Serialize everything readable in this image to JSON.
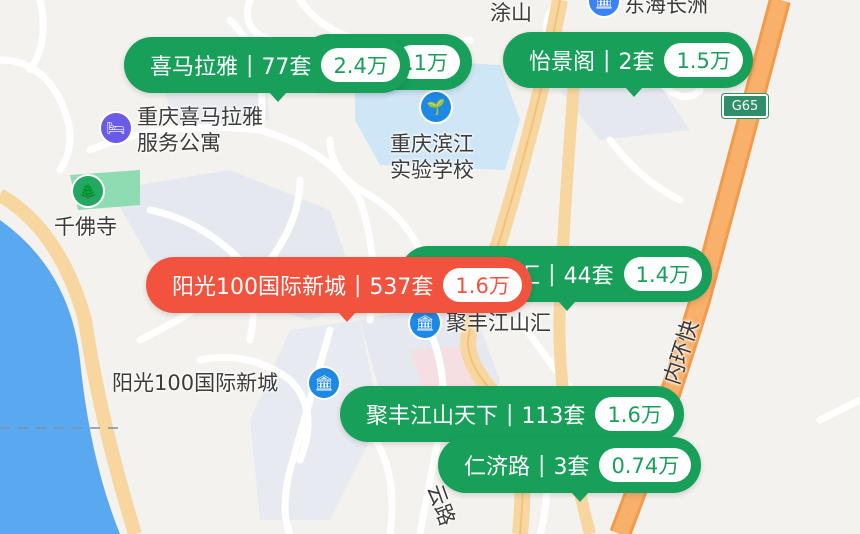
{
  "colors": {
    "listing_green": "#18a05b",
    "listing_red": "#f2533f",
    "water": "#5aa8f0",
    "expressway": "#f5a55c",
    "road_yellow": "#f8d6a0",
    "greenery": "#8fdcb3"
  },
  "highway_shield": "G65",
  "places": [
    {
      "text": "涂山"
    },
    {
      "text": "东海长洲"
    },
    {
      "text": "重庆喜马拉雅"
    },
    {
      "text": "服务公寓"
    },
    {
      "text": "重庆滨江"
    },
    {
      "text": "实验学校"
    },
    {
      "text": "千佛寺"
    },
    {
      "text": "聚丰江山汇"
    },
    {
      "text": "阳光100国际新城"
    },
    {
      "text": "内环快"
    },
    {
      "text": "云路"
    }
  ],
  "listings": [
    {
      "name": "喜马拉雅",
      "count": "77套",
      "price": "2.4万",
      "selected": false
    },
    {
      "name": "",
      "count": "",
      "price": ".1万",
      "selected": false
    },
    {
      "name": "怡景阁",
      "count": "2套",
      "price": "1.5万",
      "selected": false
    },
    {
      "name": "汇",
      "count": "44套",
      "price": "1.4万",
      "selected": false
    },
    {
      "name": "阳光100国际新城",
      "count": "537套",
      "price": "1.6万",
      "selected": true
    },
    {
      "name": "聚丰江山天下",
      "count": "113套",
      "price": "1.6万",
      "selected": false
    },
    {
      "name": "仁济路",
      "count": "3套",
      "price": "0.74万",
      "selected": false
    }
  ]
}
